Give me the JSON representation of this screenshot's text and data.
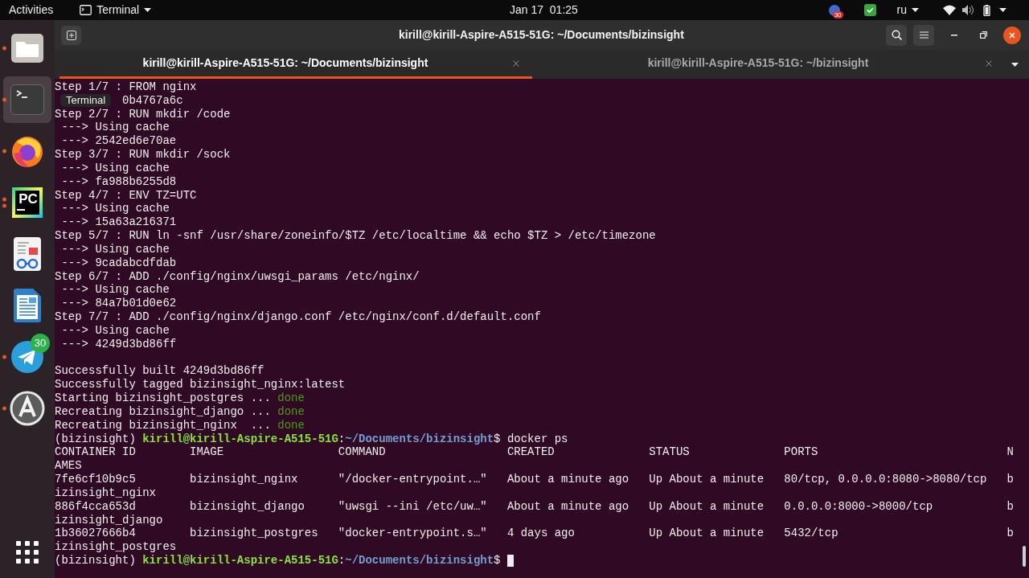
{
  "top_bar": {
    "activities": "Activities",
    "app_menu": "Terminal",
    "clock": "Jan 17  01:25",
    "notification_count": "30",
    "keyboard_layout": "ru"
  },
  "dock": {
    "items": [
      {
        "kind": "files",
        "running": true,
        "multiple_windows": false,
        "selected": false
      },
      {
        "kind": "terminal",
        "running": true,
        "multiple_windows": false,
        "selected": true
      },
      {
        "kind": "firefox",
        "running": true,
        "multiple_windows": false,
        "selected": false
      },
      {
        "kind": "pycharm",
        "running": true,
        "multiple_windows": true,
        "selected": false,
        "label": "PC"
      },
      {
        "kind": "reader",
        "running": false,
        "selected": false
      },
      {
        "kind": "writer",
        "running": false,
        "selected": false
      },
      {
        "kind": "telegram",
        "running": true,
        "multiple_windows": false,
        "selected": false,
        "badge": "30"
      },
      {
        "kind": "updater",
        "running": true,
        "multiple_windows": false,
        "selected": false
      }
    ],
    "tooltip": "Terminal"
  },
  "window": {
    "title": "kirill@kirill-Aspire-A515-51G: ~/Documents/bizinsight"
  },
  "tabs": [
    {
      "title": "kirill@kirill-Aspire-A515-51G: ~/Documents/bizinsight",
      "selected": true
    },
    {
      "title": "kirill@kirill-Aspire-A515-51G: ~/bizinsight",
      "selected": false
    }
  ],
  "terminal": {
    "lines": [
      {
        "text": "Step 1/7 : FROM nginx"
      },
      {
        "text": "0b4767a6c",
        "kind": "partly_hidden"
      },
      {
        "text": "Step 2/7 : RUN mkdir /code"
      },
      {
        "text": " ---> Using cache"
      },
      {
        "text": " ---> 2542ed6e70ae"
      },
      {
        "text": "Step 3/7 : RUN mkdir /sock"
      },
      {
        "text": " ---> Using cache"
      },
      {
        "text": " ---> fa988b6255d8"
      },
      {
        "text": "Step 4/7 : ENV TZ=UTC"
      },
      {
        "text": " ---> Using cache"
      },
      {
        "text": " ---> 15a63a216371"
      },
      {
        "text": "Step 5/7 : RUN ln -snf /usr/share/zoneinfo/$TZ /etc/localtime && echo $TZ > /etc/timezone"
      },
      {
        "text": " ---> Using cache"
      },
      {
        "text": " ---> 9cadabcdfdab"
      },
      {
        "text": "Step 6/7 : ADD ./config/nginx/uwsgi_params /etc/nginx/"
      },
      {
        "text": " ---> Using cache"
      },
      {
        "text": " ---> 84a7b01d0e62"
      },
      {
        "text": "Step 7/7 : ADD ./config/nginx/django.conf /etc/nginx/conf.d/default.conf"
      },
      {
        "text": " ---> Using cache"
      },
      {
        "text": " ---> 4249d3bd86ff"
      },
      {
        "kind": "blank"
      },
      {
        "text": "Successfully built 4249d3bd86ff"
      },
      {
        "text": "Successfully tagged bizinsight_nginx:latest"
      },
      {
        "segments": [
          {
            "kind": "plain",
            "text": "Starting bizinsight_postgres ... "
          },
          {
            "kind": "done",
            "text": "done"
          }
        ]
      },
      {
        "segments": [
          {
            "kind": "plain",
            "text": "Recreating bizinsight_django ... "
          },
          {
            "kind": "done",
            "text": "done"
          }
        ]
      },
      {
        "segments": [
          {
            "kind": "plain",
            "text": "Recreating bizinsight_nginx  ... "
          },
          {
            "kind": "done",
            "text": "done"
          }
        ]
      },
      {
        "segments": [
          {
            "kind": "plain",
            "text": "(bizinsight) "
          },
          {
            "kind": "user",
            "text": "kirill@kirill-Aspire-A515-51G"
          },
          {
            "kind": "plain",
            "text": ":"
          },
          {
            "kind": "path",
            "text": "~/Documents/bizinsight"
          },
          {
            "kind": "plain",
            "text": "$ docker ps"
          }
        ]
      },
      {
        "cells": [
          "CONTAINER ID",
          "IMAGE",
          "COMMAND",
          "CREATED",
          "STATUS",
          "PORTS",
          "N"
        ]
      },
      {
        "text": "AMES"
      },
      {
        "cells": [
          "7fe6cf10b9c5",
          "bizinsight_nginx",
          "\"/docker-entrypoint.…\"",
          "About a minute ago",
          "Up About a minute",
          "80/tcp, 0.0.0.0:8080->8080/tcp",
          "b"
        ]
      },
      {
        "text": "izinsight_nginx"
      },
      {
        "cells": [
          "886f4cca653d",
          "bizinsight_django",
          "\"uwsgi --ini /etc/uw…\"",
          "About a minute ago",
          "Up About a minute",
          "0.0.0.0:8000->8000/tcp",
          "b"
        ]
      },
      {
        "text": "izinsight_django"
      },
      {
        "cells": [
          "1b36027666b4",
          "bizinsight_postgres",
          "\"docker-entrypoint.s…\"",
          "4 days ago",
          "Up About a minute",
          "5432/tcp",
          "b"
        ]
      },
      {
        "text": "izinsight_postgres"
      },
      {
        "segments": [
          {
            "kind": "plain",
            "text": "(bizinsight) "
          },
          {
            "kind": "user",
            "text": "kirill@kirill-Aspire-A515-51G"
          },
          {
            "kind": "plain",
            "text": ":"
          },
          {
            "kind": "path",
            "text": "~/Documents/bizinsight"
          },
          {
            "kind": "plain",
            "text": "$ "
          }
        ],
        "cursor": true
      }
    ]
  }
}
